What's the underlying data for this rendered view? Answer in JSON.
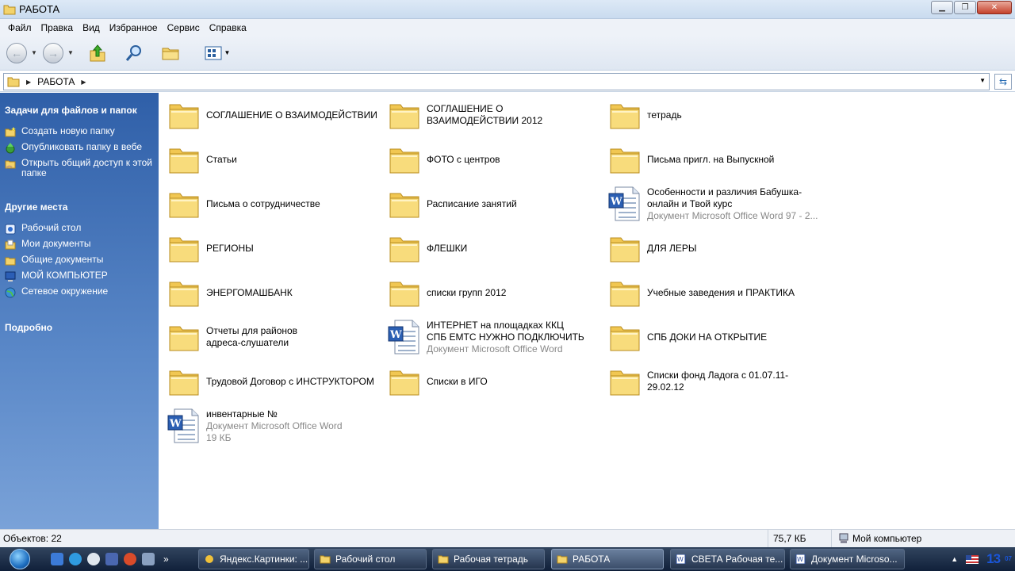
{
  "window": {
    "title": "РАБОТА"
  },
  "menu": [
    "Файл",
    "Правка",
    "Вид",
    "Избранное",
    "Сервис",
    "Справка"
  ],
  "toolbar": {
    "icons": [
      "back-icon",
      "forward-icon",
      "up-folder-icon",
      "search-icon",
      "folders-icon",
      "views-icon"
    ]
  },
  "address": {
    "path": "РАБОТА"
  },
  "left_panel": {
    "tasks_title": "Задачи для файлов и папок",
    "tasks": [
      {
        "label": "Создать новую папку",
        "icon": "new-folder-icon"
      },
      {
        "label": "Опубликовать папку в вебе",
        "icon": "publish-web-icon"
      },
      {
        "label": "Открыть общий доступ к этой папке",
        "icon": "share-folder-icon"
      }
    ],
    "places_title": "Другие места",
    "places": [
      {
        "label": "Рабочий стол",
        "icon": "desktop-icon"
      },
      {
        "label": "Мои документы",
        "icon": "my-documents-icon"
      },
      {
        "label": "Общие документы",
        "icon": "shared-documents-icon"
      },
      {
        "label": "МОЙ КОМПЬЮТЕР",
        "icon": "my-computer-icon"
      },
      {
        "label": "Сетевое окружение",
        "icon": "network-icon"
      }
    ],
    "details_title": "Подробно"
  },
  "items": [
    {
      "name": "СОГЛАШЕНИЕ О ВЗАИМОДЕЙСТВИИ",
      "type": "folder"
    },
    {
      "name": "СОГЛАШЕНИЕ О ВЗАИМОДЕЙСТВИИ 2012",
      "type": "folder"
    },
    {
      "name": "тетрадь",
      "type": "folder"
    },
    {
      "name": "Статьи",
      "type": "folder"
    },
    {
      "name": "ФОТО с центров",
      "type": "folder"
    },
    {
      "name": "Письма пригл. на Выпускной",
      "type": "folder"
    },
    {
      "name": "Письма о сотрудничестве",
      "type": "folder"
    },
    {
      "name": "Расписание занятий",
      "type": "folder"
    },
    {
      "name": "Особенности и различия Бабушка-онлайн и Твой курс",
      "type": "word",
      "sub1": "Документ Microsoft Office Word 97 - 2..."
    },
    {
      "name": "РЕГИОНЫ",
      "type": "folder"
    },
    {
      "name": "ФЛЕШКИ",
      "type": "folder"
    },
    {
      "name": "ДЛЯ ЛЕРЫ",
      "type": "folder"
    },
    {
      "name": "ЭНЕРГОМАШБАНК",
      "type": "folder"
    },
    {
      "name": "списки групп 2012",
      "type": "folder"
    },
    {
      "name": "Учебные заведения и ПРАКТИКА",
      "type": "folder"
    },
    {
      "name": "Отчеты для районов адреса-слушатели",
      "type": "folder"
    },
    {
      "name": "ИНТЕРНЕТ на площадках ККЦ СПБ ЕМТС НУЖНО ПОДКЛЮЧИТЬ",
      "type": "word",
      "sub1": "Документ Microsoft Office Word"
    },
    {
      "name": "СПБ ДОКИ НА ОТКРЫТИЕ",
      "type": "folder"
    },
    {
      "name": "Трудовой Договор с ИНСТРУКТОРОМ",
      "type": "folder"
    },
    {
      "name": "Списки в ИГО",
      "type": "folder"
    },
    {
      "name": "Списки фонд Ладога с 01.07.11-29.02.12",
      "type": "folder"
    },
    {
      "name": "инвентарные №",
      "type": "word",
      "sub1": "Документ Microsoft Office Word",
      "sub2": "19 КБ"
    }
  ],
  "status": {
    "objects": "Объектов: 22",
    "size": "75,7 КБ",
    "location": "Мой компьютер"
  },
  "taskbar": {
    "tasks": [
      {
        "label": "Яндекс.Картинки: ...",
        "icon": "browser-icon"
      },
      {
        "label": "Рабочий стол",
        "icon": "folder-icon"
      },
      {
        "label": "Рабочая тетрадь",
        "icon": "folder-icon"
      },
      {
        "label": "РАБОТА",
        "icon": "folder-icon"
      },
      {
        "label": "СВЕТА Рабочая те...",
        "icon": "word-icon"
      },
      {
        "label": "Документ Microso...",
        "icon": "word-icon"
      }
    ],
    "clock": "13",
    "clock_sup": "07"
  }
}
